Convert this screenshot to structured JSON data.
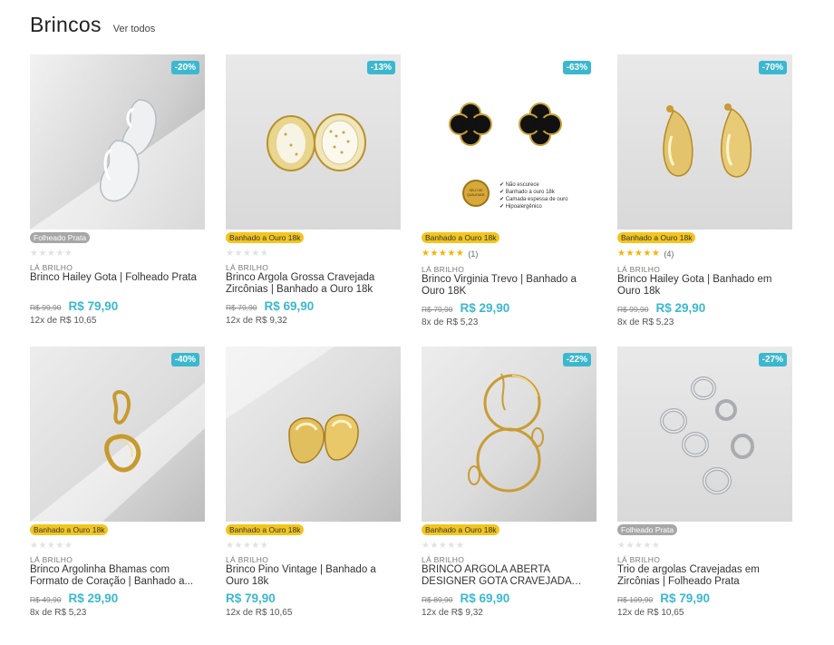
{
  "section": {
    "title": "Brincos",
    "view_all": "Ver todos"
  },
  "products": [
    {
      "discount": "-20%",
      "material": "Folheado Prata",
      "rating_count": "",
      "brand": "LÁ BRILHO",
      "name": "Brinco Hailey Gota | Folheado Prata",
      "old_price": "R$ 99,90",
      "price": "R$ 79,90",
      "installments": "12x de R$ 10,65"
    },
    {
      "discount": "-13%",
      "material": "Banhado a Ouro 18k",
      "rating_count": "",
      "brand": "LÁ BRILHO",
      "name": "Brinco Argola Grossa Cravejada Zircônias | Banhado a Ouro 18k",
      "old_price": "R$ 79,90",
      "price": "R$ 69,90",
      "installments": "12x de R$ 9,32"
    },
    {
      "discount": "-63%",
      "material": "Banhado a Ouro 18k",
      "rating_count": "(1)",
      "brand": "LÁ BRILHO",
      "name": "Brinco Virginia Trevo | Banhado a Ouro 18K",
      "old_price": "R$ 79,90",
      "price": "R$ 29,90",
      "installments": "8x de R$ 5,23",
      "image_text": {
        "seal": "SELO DE QUALIDADE",
        "features": [
          "Não escurece",
          "Banhado a ouro 18k",
          "Camada espessa de ouro",
          "Hipoalergênico"
        ]
      }
    },
    {
      "discount": "-70%",
      "material": "Banhado a Ouro 18k",
      "rating_count": "(4)",
      "brand": "LÁ BRILHO",
      "name": "Brinco Hailey Gota | Banhado em Ouro 18k",
      "old_price": "R$ 99,90",
      "price": "R$ 29,90",
      "installments": "8x de R$ 5,23"
    },
    {
      "discount": "-40%",
      "material": "Banhado a Ouro 18k",
      "rating_count": "",
      "brand": "LÁ BRILHO",
      "name": "Brinco Argolinha Bhamas com Formato de Coração | Banhado a...",
      "old_price": "R$ 49,90",
      "price": "R$ 29,90",
      "installments": "8x de R$ 5,23"
    },
    {
      "discount": "",
      "material": "Banhado a Ouro 18k",
      "rating_count": "",
      "brand": "LÁ BRILHO",
      "name": "Brinco Pino Vintage | Banhado a Ouro 18k",
      "old_price": "",
      "price": "R$ 79,90",
      "installments": "12x de R$ 10,65"
    },
    {
      "discount": "-22%",
      "material": "Banhado a Ouro 18k",
      "rating_count": "",
      "brand": "LÁ BRILHO",
      "name": "BRINCO ARGOLA ABERTA DESIGNER GOTA CRAVEJADA EM...",
      "old_price": "R$ 89,90",
      "price": "R$ 69,90",
      "installments": "12x de R$ 9,32"
    },
    {
      "discount": "-27%",
      "material": "Folheado Prata",
      "rating_count": "",
      "brand": "LÁ BRILHO",
      "name": "Trio de argolas Cravejadas em Zircônias | Folheado Prata",
      "old_price": "R$ 109,90",
      "price": "R$ 79,90",
      "installments": "12x de R$ 10,65"
    }
  ],
  "colors": {
    "accent": "#3bb8cf",
    "gold_badge": "#f2c51f",
    "silver_badge": "#a7a7a7",
    "star": "#f5b400"
  }
}
